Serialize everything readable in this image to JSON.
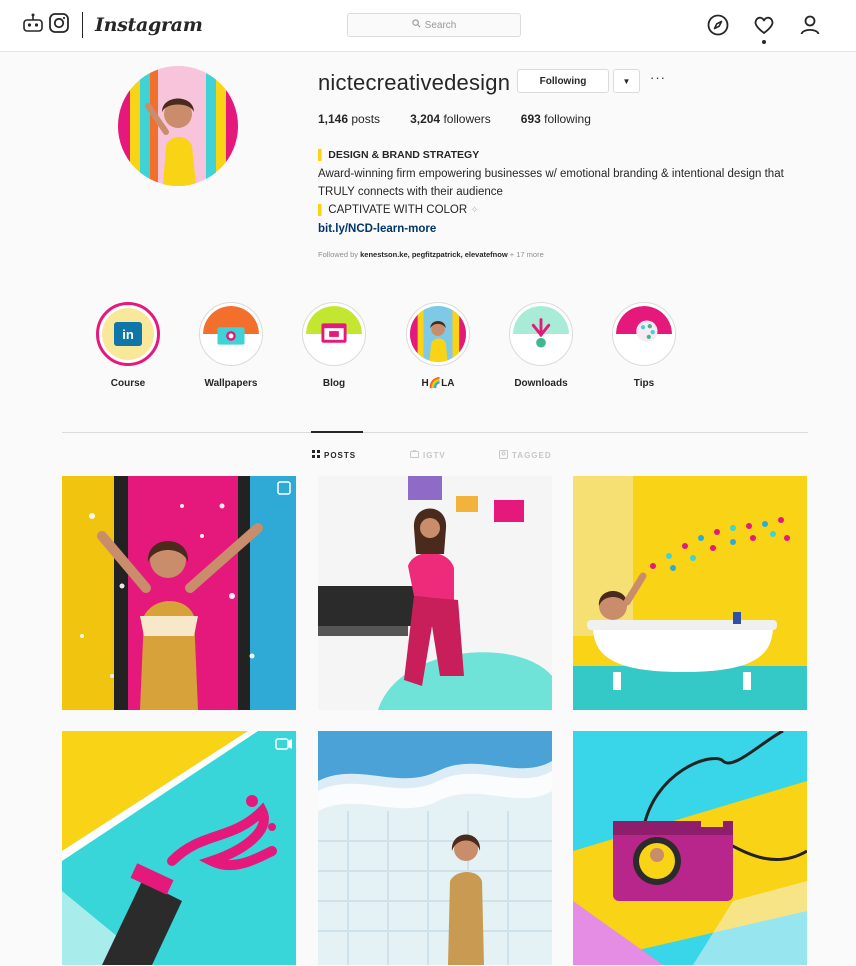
{
  "nav": {
    "brand": "Instagram",
    "search_placeholder": "Search"
  },
  "profile": {
    "username": "nictecreativedesign",
    "following_label": "Following",
    "posts_count": "1,146",
    "posts_label": "posts",
    "followers_count": "3,204",
    "followers_label": "followers",
    "following_count": "693",
    "following_count_label": "following",
    "bio_title": "DESIGN & BRAND STRATEGY",
    "bio_text": "Award-winning firm empowering businesses w/ emotional branding & intentional design that TRULY connects with their audience",
    "bio_tagline": "CAPTIVATE WITH COLOR",
    "bio_link": "bit.ly/NCD-learn-more",
    "followed_by_prefix": "Followed by",
    "followed_by_names": "kenestson.ke, pegfitzpatrick, elevatefnow",
    "followed_by_more": "+ 17 more"
  },
  "highlights": [
    {
      "label": "Course"
    },
    {
      "label": "Wallpapers"
    },
    {
      "label": "Blog"
    },
    {
      "label": "H🌈LA"
    },
    {
      "label": "Downloads"
    },
    {
      "label": "Tips"
    }
  ],
  "tabs": [
    {
      "label": "POSTS"
    },
    {
      "label": "IGTV"
    },
    {
      "label": "TAGGED"
    }
  ],
  "colors": {
    "brand_pink": "#e5197b",
    "brand_yellow": "#f9d316",
    "brand_teal": "#3fd3d6",
    "brand_orange": "#f36f2c",
    "link": "#003569"
  }
}
